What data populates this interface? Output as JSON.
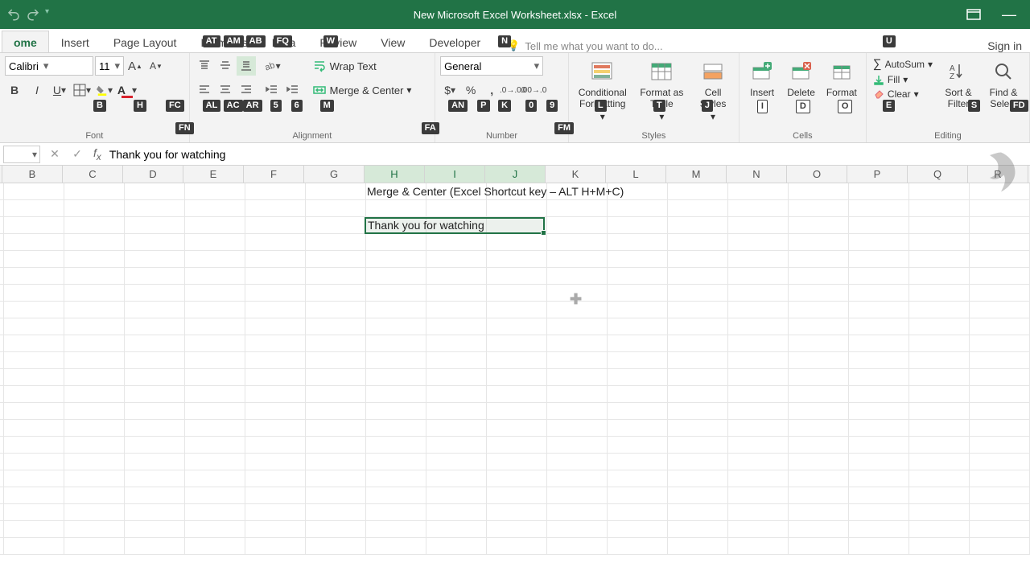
{
  "window": {
    "title": "New Microsoft Excel Worksheet.xlsx - Excel",
    "sign_in": "Sign in"
  },
  "tabs": {
    "home": "ome",
    "insert": "Insert",
    "page_layout": "Page Layout",
    "formulas": "Formulas",
    "data": "Data",
    "review": "Review",
    "view": "View",
    "developer": "Developer",
    "tellme": "Tell me what you want to do..."
  },
  "ribbon": {
    "font": {
      "label": "Font",
      "name": "Calibri",
      "size": "11"
    },
    "alignment": {
      "label": "Alignment",
      "wrap": "Wrap Text",
      "merge": "Merge & Center"
    },
    "number": {
      "label": "Number",
      "format": "General"
    },
    "styles": {
      "label": "Styles",
      "conditional": "Conditional Formatting",
      "format_table": "Format as Table",
      "cell_styles": "Cell Styles"
    },
    "cells": {
      "label": "Cells",
      "insert": "Insert",
      "delete": "Delete",
      "format": "Format"
    },
    "editing": {
      "label": "Editing",
      "autosum": "AutoSum",
      "fill": "Fill",
      "clear": "Clear",
      "sort": "Sort & Filter",
      "find": "Find & Select"
    }
  },
  "keytips": {
    "at": "AT",
    "am": "AM",
    "ab": "AB",
    "fq": "FQ",
    "w": "W",
    "n": "N",
    "b": "B",
    "h": "H",
    "fc": "FC",
    "fn": "FN",
    "al": "AL",
    "ac": "AC",
    "ar": "AR",
    "k5": "5",
    "k6": "6",
    "m": "M",
    "fa": "FA",
    "an": "AN",
    "p": "P",
    "k": "K",
    "k0": "0",
    "k9": "9",
    "fm": "FM",
    "l": "L",
    "t": "T",
    "j": "J",
    "i": "I",
    "d": "D",
    "o": "O",
    "u": "U",
    "e": "E",
    "s": "S",
    "fd": "FD"
  },
  "formula_bar": {
    "value": "Thank you for watching"
  },
  "sheet": {
    "columns": [
      "B",
      "C",
      "D",
      "E",
      "F",
      "G",
      "H",
      "I",
      "J",
      "K",
      "L",
      "M",
      "N",
      "O",
      "P",
      "Q",
      "R"
    ],
    "selected_cols": [
      "H",
      "I",
      "J"
    ],
    "title_cell": "Merge & Center (Excel Shortcut key – ALT H+M+C)",
    "sel_text": "Thank you for watching"
  }
}
